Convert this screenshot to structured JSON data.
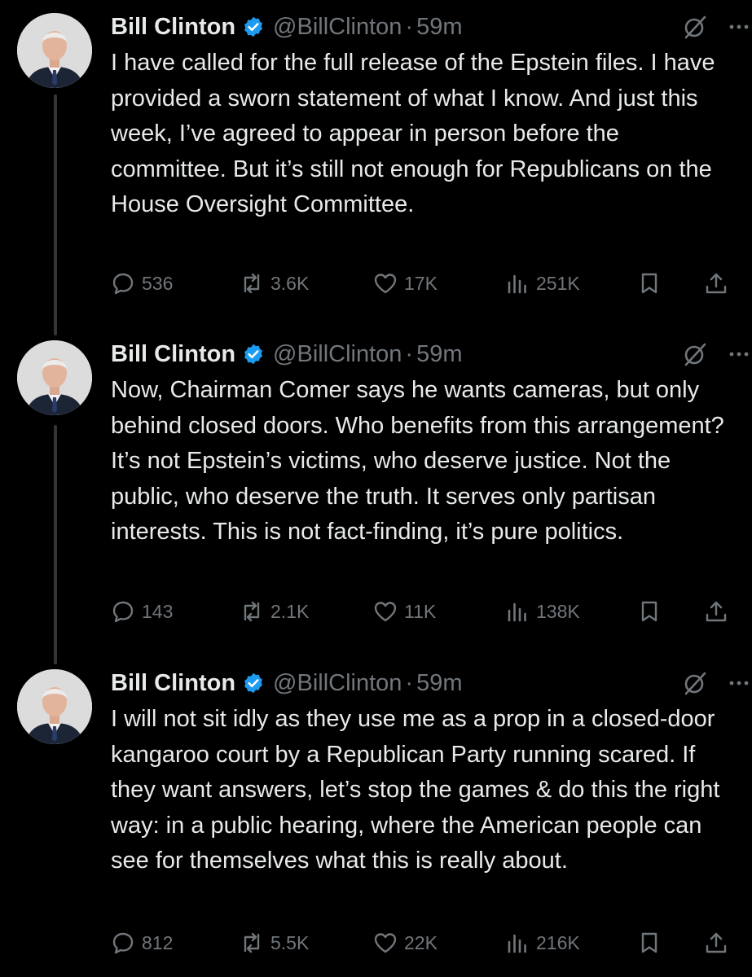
{
  "tweets": [
    {
      "author": {
        "name": "Bill Clinton",
        "handle": "@BillClinton",
        "verified": true
      },
      "time": "59m",
      "text": "I have called for the full release of the Epstein files. I have provided a sworn statement of what I know. And just this week, I’ve agreed to appear in person before the committee. But it’s still not enough for Republicans on the House Oversight Committee.",
      "replies": "536",
      "reposts": "3.6K",
      "likes": "17K",
      "views": "251K"
    },
    {
      "author": {
        "name": "Bill Clinton",
        "handle": "@BillClinton",
        "verified": true
      },
      "time": "59m",
      "text": "Now, Chairman Comer says he wants cameras, but only behind closed doors. Who benefits from this arrangement? It’s not Epstein’s victims, who deserve justice. Not the public, who deserve the truth. It serves only partisan interests. This is not fact-finding, it’s pure politics.",
      "replies": "143",
      "reposts": "2.1K",
      "likes": "11K",
      "views": "138K"
    },
    {
      "author": {
        "name": "Bill Clinton",
        "handle": "@BillClinton",
        "verified": true
      },
      "time": "59m",
      "text": "I will not sit idly as they use me as a prop in a closed-door kangaroo court by a Republican Party running scared. If they want answers, let’s stop the games & do this the right way: in a public hearing, where the American people can see for themselves what this is really about.",
      "replies": "812",
      "reposts": "5.5K",
      "likes": "22K",
      "views": "216K"
    }
  ],
  "separator": "·",
  "icons": {
    "verified": "verified-badge-icon",
    "grok": "grok-icon",
    "more": "more-icon",
    "reply": "reply-icon",
    "repost": "repost-icon",
    "like": "like-icon",
    "views": "views-icon",
    "bookmark": "bookmark-icon",
    "share": "share-icon"
  },
  "colors": {
    "background": "#000000",
    "text": "#e7e9ea",
    "secondary": "#71767b",
    "verified": "#1d9bf0",
    "thread_line": "#333639"
  }
}
